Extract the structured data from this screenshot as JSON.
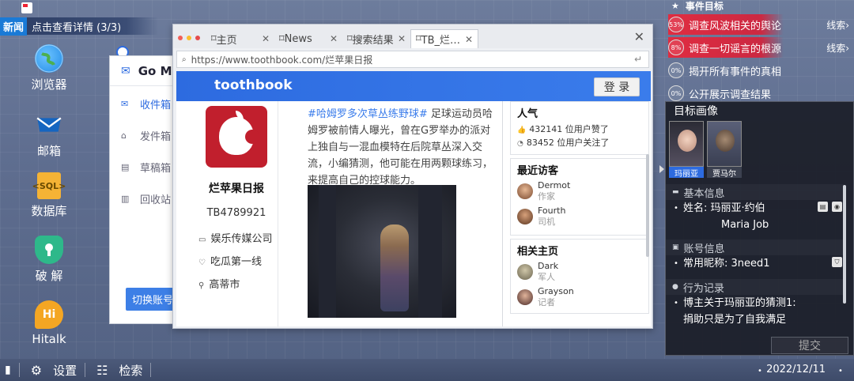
{
  "news_bar": {
    "tag": "新闻",
    "text": "点击查看详情 (3/3)"
  },
  "desktop_icons": [
    {
      "label": "浏览器",
      "icon": "globe-icon",
      "color": "#1e88e5"
    },
    {
      "label": "邮箱",
      "icon": "mail-icon",
      "color": "#1565c0"
    },
    {
      "label": "数据库",
      "icon": "sql-file-icon",
      "color": "#f5b335",
      "text": "<SQL>"
    },
    {
      "label": "破 解",
      "icon": "shield-lock-icon",
      "color": "#2eb88a"
    },
    {
      "label": "Hitalk",
      "icon": "hitalk-icon",
      "color": "#f4a623",
      "text": "Hi"
    }
  ],
  "mail_window": {
    "title": "Go M",
    "items": [
      "收件箱",
      "发件箱",
      "草稿箱",
      "回收站"
    ],
    "switch_button": "切换账号"
  },
  "browser": {
    "tabs": [
      {
        "label": "主页",
        "active": false
      },
      {
        "label": "News",
        "active": false
      },
      {
        "label": "搜索结果",
        "active": false
      },
      {
        "label": "TB_烂…",
        "active": true
      }
    ],
    "url": "https://www.toothbook.com/烂苹果日报",
    "site": {
      "logo": "toothbook",
      "login_button": "登 录",
      "profile": {
        "name": "烂苹果日报",
        "id": "TB4789921",
        "company": "娱乐传媒公司",
        "motto": "吃瓜第一线",
        "city": "高蒂市"
      },
      "post": {
        "hashtag": "#哈姆罗多次草丛练野球#",
        "text": " 足球运动员哈姆罗被前情人曝光，曾在G罗举办的派对上独自与一混血模特在后院草丛深入交流，小编猜测，他可能在用两颗球练习，来提高自己的控球能力。"
      },
      "popularity": {
        "title": "人气",
        "likes": "432141 位用户赞了",
        "follows": "83452 位用户关注了"
      },
      "visitors": {
        "title": "最近访客",
        "people": [
          {
            "name": "Dermot",
            "role": "作家"
          },
          {
            "name": "Fourth",
            "role": "司机"
          }
        ]
      },
      "related": {
        "title": "相关主页",
        "people": [
          {
            "name": "Dark",
            "role": "军人"
          },
          {
            "name": "Grayson",
            "role": "记者"
          }
        ]
      }
    }
  },
  "event_panel": {
    "title": "事件目标",
    "tasks": [
      {
        "pct": "53%",
        "label": "调查风波相关的舆论",
        "clue": "线索›",
        "highlight": true
      },
      {
        "pct": "8%",
        "label": "调查一切谣言的根源",
        "clue": "线索›",
        "highlight": true
      },
      {
        "pct": "0%",
        "label": "揭开所有事件的真相",
        "clue": "",
        "highlight": false
      },
      {
        "pct": "0%",
        "label": "公开展示调查结果",
        "clue": "",
        "highlight": false
      }
    ]
  },
  "target_panel": {
    "title": "目标画像",
    "portraits": [
      {
        "name": "玛丽亚",
        "selected": true
      },
      {
        "name": "贾马尔",
        "selected": false
      }
    ],
    "basic_info": {
      "title": "基本信息",
      "name_label": "姓名:  玛丽亚·约伯",
      "name_en": "Maria Job"
    },
    "account_info": {
      "title": "账号信息",
      "nickname": "常用昵称: 3need1"
    },
    "records": {
      "title": "行为记录",
      "line1": "博主关于玛丽亚的猜测1:",
      "line2": "捐助只是为了自我满足"
    },
    "submit": "提交"
  },
  "taskbar": {
    "settings": "设置",
    "search": "检索",
    "date": "2022/12/11"
  }
}
